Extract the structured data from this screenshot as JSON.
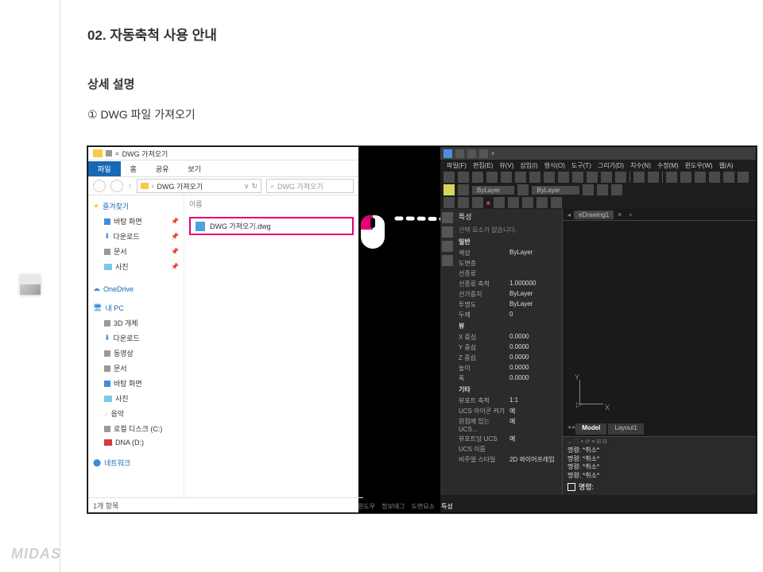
{
  "doc": {
    "title": "02. 자동축척 사용 안내",
    "subtitle": "상세 설명",
    "step": "① DWG 파일 가져오기",
    "brand": "MIDAS"
  },
  "explorer": {
    "title": "DWG 가져오기",
    "tabs": {
      "file": "파일",
      "home": "홈",
      "share": "공유",
      "view": "보기"
    },
    "crumb": "DWG 가져오기",
    "search_placeholder": "DWG 가져오기",
    "column": "이름",
    "file_name": "DWG 가져오기.dwg",
    "status": "1개 항목",
    "quick": "즐겨찾기",
    "onedrive": "OneDrive",
    "thispc": "내 PC",
    "network": "네트워크",
    "fav": [
      "바탕 화면",
      "다운로드",
      "문서",
      "사진"
    ],
    "thispc_items": [
      "3D 개체",
      "다운로드",
      "동영상",
      "문서",
      "바탕 화면",
      "사진",
      "음악",
      "로컬 디스크 (C:)",
      "DNA (D:)"
    ]
  },
  "cad": {
    "menus": [
      "파일(F)",
      "편집(E)",
      "뷰(V)",
      "삽입(I)",
      "형식(O)",
      "도구(T)",
      "그리기(D)",
      "치수(N)",
      "수정(M)",
      "윈도우(W)",
      "웹(A)"
    ],
    "drawing_tab": "eDrawing1",
    "prop_title": "특성",
    "prop_msg": "선택 요소가 없습니다.",
    "sec1": "일반",
    "sec2": "뷰",
    "sec3": "기타",
    "sec1_rows": [
      [
        "색상",
        "ByLayer"
      ],
      [
        "도면층",
        ""
      ],
      [
        "선종류",
        ""
      ],
      [
        "선종류 축척",
        "1.000000"
      ],
      [
        "선가중치",
        "ByLayer"
      ],
      [
        "투명도",
        "ByLayer"
      ],
      [
        "두께",
        "0"
      ]
    ],
    "sec2_rows": [
      [
        "X 중심",
        "0.0000"
      ],
      [
        "Y 중심",
        "0.0000"
      ],
      [
        "Z 중심",
        "0.0000"
      ],
      [
        "높이",
        "0.0000"
      ],
      [
        "폭",
        "0.0000"
      ]
    ],
    "sec3_rows": [
      [
        "뷰포트 축척",
        "1:1"
      ],
      [
        "UCS 아이콘 켜기",
        "예"
      ],
      [
        "원점에 있는 UCS...",
        "예"
      ],
      [
        "뷰포트당 UCS",
        "예"
      ],
      [
        "UCS 이름",
        ""
      ],
      [
        "비주얼 스타일",
        "2D 와이어프레임"
      ]
    ],
    "axis_y": "Y",
    "axis_x": "X",
    "origin": "▷",
    "model_tab": "Model",
    "layout_tab": "Layout1",
    "cmd_lines": [
      "명령: *취소*",
      "명령: *취소*",
      "명령: *취소*",
      "명령: *취소*"
    ],
    "cmd_label": "명령:",
    "status_items": [
      "윈도우",
      "정보태그",
      "도면요소",
      "특성"
    ],
    "tb2_select": "ByLayer",
    "tb2_select2": "ByLayer"
  }
}
